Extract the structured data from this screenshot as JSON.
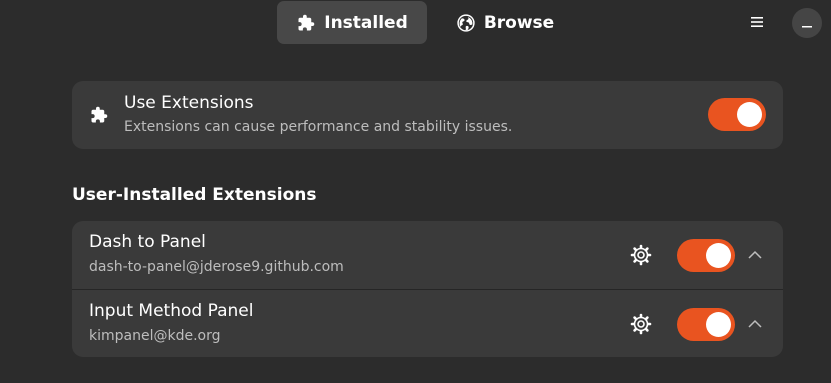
{
  "header": {
    "tabs": [
      {
        "label": "Installed",
        "icon": "puzzle-icon",
        "active": true
      },
      {
        "label": "Browse",
        "icon": "globe-icon",
        "active": false
      }
    ],
    "menu_icon": "hamburger-menu-icon",
    "close_icon": "minimize-icon"
  },
  "use_extensions": {
    "title": "Use Extensions",
    "subtitle": "Extensions can cause performance and stability issues.",
    "enabled": true
  },
  "section": {
    "title": "User-Installed Extensions"
  },
  "extensions": [
    {
      "name": "Dash to Panel",
      "id": "dash-to-panel@jderose9.github.com",
      "enabled": true
    },
    {
      "name": "Input Method Panel",
      "id": "kimpanel@kde.org",
      "enabled": true
    }
  ],
  "colors": {
    "accent": "#e95420",
    "background": "#2c2c2c",
    "card": "#3a3a3a",
    "active_tab": "#484848"
  }
}
